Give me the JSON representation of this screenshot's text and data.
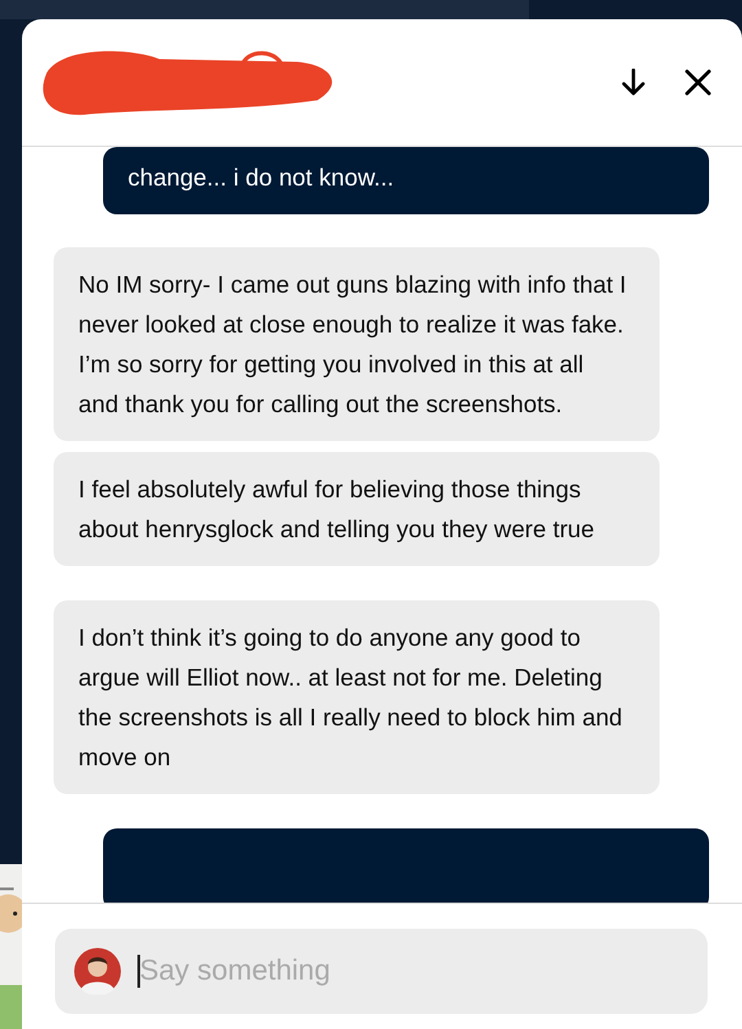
{
  "chat": {
    "header": {
      "redacted": true
    },
    "messages": [
      {
        "kind": "sent",
        "text": "change... i do not know..."
      },
      {
        "kind": "received",
        "text": "No IM sorry- I came out guns blazing with info that I never looked at close enough to realize it was fake. I’m so sorry for getting you involved in this at all and thank you for calling out the screenshots."
      },
      {
        "kind": "received",
        "text": "I feel absolutely awful for believing those things about henrysglock and telling you they were true"
      },
      {
        "kind": "received",
        "text": "I don’t think it’s going to do anyone any good to argue will Elliot now.. at least not for me. Deleting the screenshots is all I really need to block him and move on"
      },
      {
        "kind": "sent"
      }
    ],
    "composer": {
      "placeholder": "Say something"
    }
  }
}
